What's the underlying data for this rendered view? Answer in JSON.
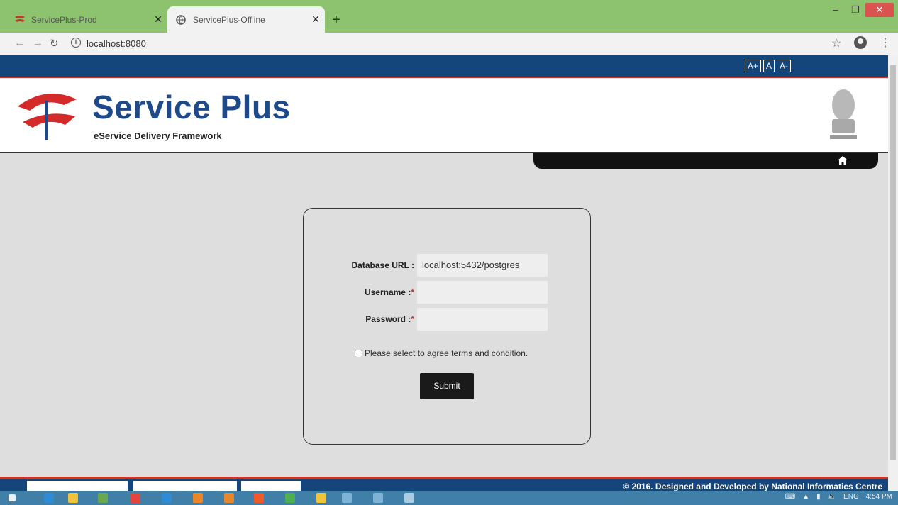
{
  "browser": {
    "tabs": [
      {
        "label": "ServicePlus-Prod",
        "active": false
      },
      {
        "label": "ServicePlus-Offline",
        "active": true
      }
    ],
    "url": "localhost:8080"
  },
  "site": {
    "font_controls": [
      "A+",
      "A",
      "A-"
    ],
    "brand_title": "Service Plus",
    "brand_subtitle": "eService Delivery Framework"
  },
  "login_form": {
    "database_url_label": "Database URL :",
    "database_url_value": "localhost:5432/postgres",
    "username_label": "Username :",
    "username_value": "",
    "password_label": "Password :",
    "password_value": "",
    "required_marker": "*",
    "terms_label": "Please select to agree terms and condition.",
    "terms_checked": false,
    "submit_label": "Submit"
  },
  "footer": {
    "copyright": "© 2016. Designed and Developed by National Informatics Centre"
  },
  "taskbar": {
    "language": "ENG",
    "time": "4:54 PM"
  },
  "colors": {
    "tabstrip": "#8dc26e",
    "topbar": "#14457b",
    "accent_red": "#c0392b",
    "brand_blue": "#1e4a8c"
  }
}
